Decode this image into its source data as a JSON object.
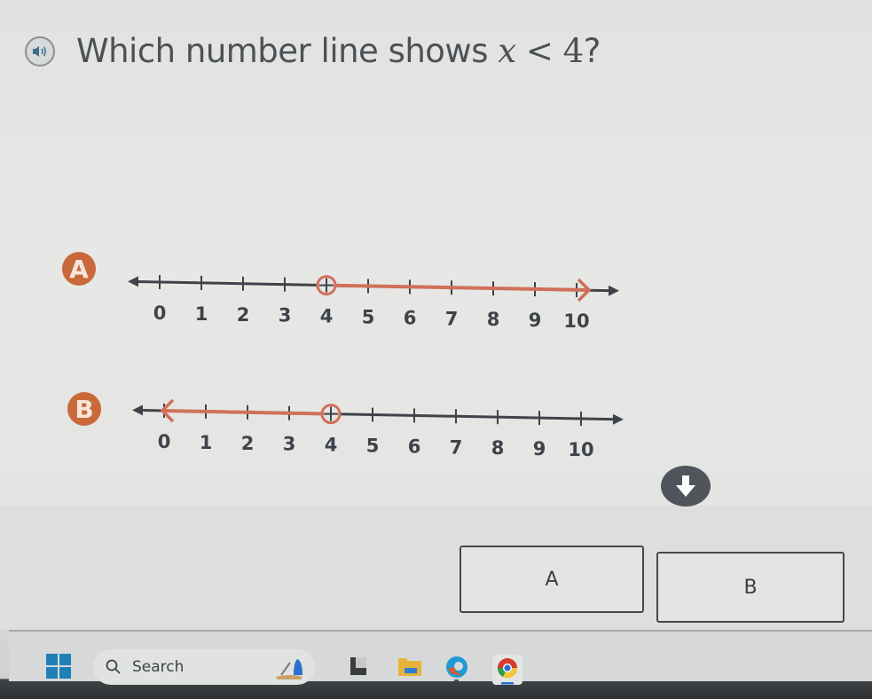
{
  "question": {
    "prefix": "Which number line shows ",
    "variable": "x",
    "relation": " < 4",
    "suffix": "?",
    "audio_icon": "speaker-icon"
  },
  "options": [
    {
      "label": "A",
      "ticks": [
        "0",
        "1",
        "2",
        "3",
        "4",
        "5",
        "6",
        "7",
        "8",
        "9",
        "10"
      ],
      "open_circle_at": 4,
      "ray_direction": "right",
      "ray_end": 10
    },
    {
      "label": "B",
      "ticks": [
        "0",
        "1",
        "2",
        "3",
        "4",
        "5",
        "6",
        "7",
        "8",
        "9",
        "10"
      ],
      "open_circle_at": 4,
      "ray_direction": "left",
      "ray_end": 0
    }
  ],
  "scroll_icon": "arrow-down-circle-icon",
  "answers": [
    {
      "label": "A"
    },
    {
      "label": "B"
    }
  ],
  "taskbar": {
    "search_placeholder": "Search",
    "icons": [
      "windows-start-icon",
      "search-icon",
      "widgets-icon",
      "task-view-icon",
      "file-explorer-icon",
      "edge-icon",
      "chrome-icon"
    ]
  },
  "colors": {
    "ray": "#d0705a",
    "axis": "#3e434a",
    "badge": "#c9693a"
  }
}
